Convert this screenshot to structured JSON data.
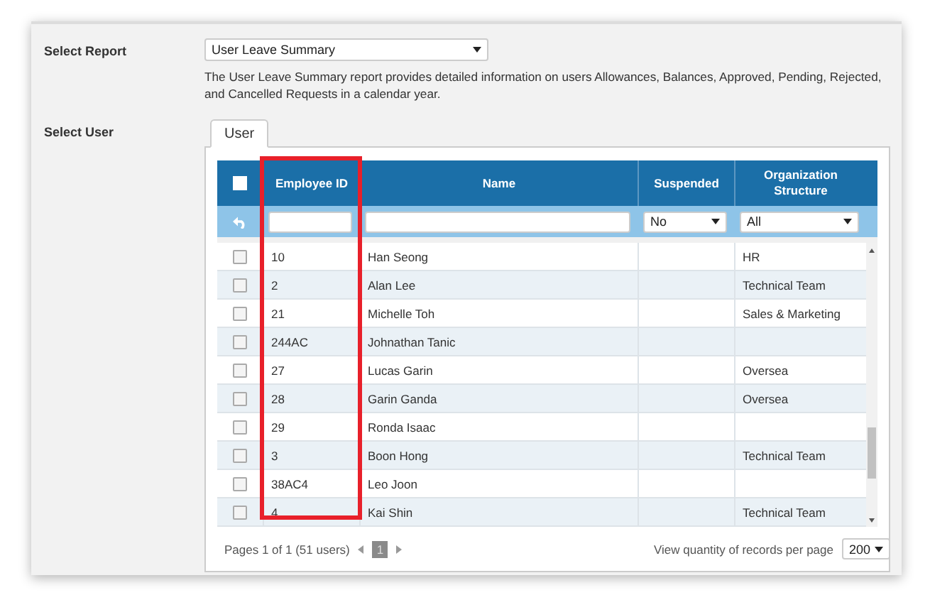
{
  "report": {
    "label": "Select Report",
    "value": "User Leave Summary",
    "description": "The User Leave Summary report provides detailed information on users Allowances, Balances, Approved, Pending, Rejected, and Cancelled Requests in a calendar year."
  },
  "user_section": {
    "label": "Select User",
    "tabs": [
      {
        "label": "User",
        "selected": true
      }
    ]
  },
  "table": {
    "select_all": {
      "checked": false
    },
    "columns": [
      {
        "label": "Employee ID",
        "highlighted": true
      },
      {
        "label": "Name",
        "highlighted": false
      },
      {
        "label": "Suspended",
        "highlighted": false
      },
      {
        "label": "Organization Structure",
        "highlighted": false
      }
    ],
    "filters": [
      {
        "kind": "text"
      },
      {
        "kind": "text"
      },
      {
        "kind": "select",
        "value": "No"
      },
      {
        "kind": "select",
        "value": "All"
      }
    ],
    "rows": [
      {
        "checked": false,
        "employee_id": "10",
        "name": "Han Seong",
        "organization": "HR"
      },
      {
        "checked": false,
        "employee_id": "2",
        "name": "Alan Lee",
        "organization": "Technical Team"
      },
      {
        "checked": false,
        "employee_id": "21",
        "name": "Michelle Toh",
        "organization": "Sales & Marketing"
      },
      {
        "checked": false,
        "employee_id": "244AC",
        "name": "Johnathan Tanic"
      },
      {
        "checked": false,
        "employee_id": "27",
        "name": "Lucas Garin",
        "organization": "Oversea"
      },
      {
        "checked": false,
        "employee_id": "28",
        "name": "Garin Ganda",
        "organization": "Oversea"
      },
      {
        "checked": false,
        "employee_id": "29",
        "name": "Ronda Isaac"
      },
      {
        "checked": false,
        "employee_id": "3",
        "name": "Boon Hong",
        "organization": "Technical Team"
      },
      {
        "checked": false,
        "employee_id": "38AC4",
        "name": "Leo Joon"
      },
      {
        "checked": false,
        "employee_id": "4",
        "name": "Kai Shin",
        "organization": "Technical Team"
      }
    ]
  },
  "pager": {
    "summary": "Pages 1 of 1 (51 users)",
    "pages": [
      {
        "label": "1",
        "selected": true
      }
    ],
    "per_page_label": "View quantity of records per page",
    "per_page": "200"
  }
}
